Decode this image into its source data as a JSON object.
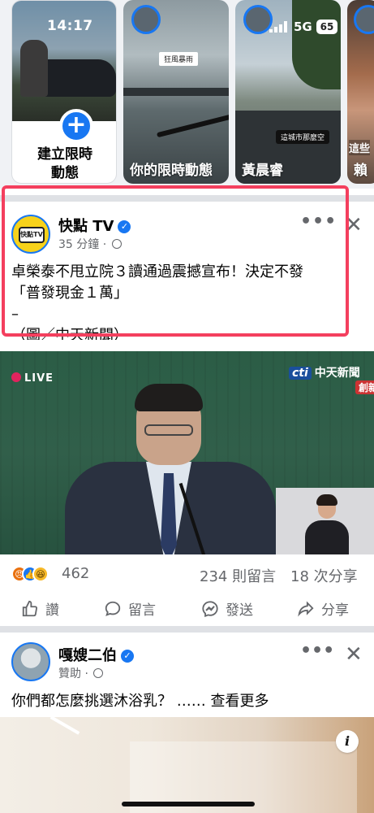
{
  "status_bar": {
    "time": "14:17",
    "network": "5G",
    "battery": "65"
  },
  "stories": {
    "create": {
      "label_line1": "建立限時",
      "label_line2": "動態"
    },
    "items": [
      {
        "name": "你的限時動態",
        "tag": "狂風暴雨"
      },
      {
        "name": "黃晨睿",
        "tag": "這城市那麼空"
      },
      {
        "name": "賴",
        "tag": "這些"
      }
    ]
  },
  "post1": {
    "page_name": "快點 TV",
    "avatar_text": "快點TV",
    "time": "35 分鐘",
    "text_line1": "卓榮泰不甩立院３讀通過震撼宣布！決定不發",
    "text_line2": "「普發現金１萬」",
    "text_line3": "–",
    "text_line4": "（圖／中天新聞）",
    "video": {
      "live_label": "LIVE",
      "channel_logo": "cti",
      "channel_name": "中天新聞",
      "channel_sub": "創新"
    },
    "reaction_count": "462",
    "comments": "234 則留言",
    "shares": "18 次分享",
    "actions": {
      "like": "讚",
      "comment": "留言",
      "send": "發送",
      "share": "分享"
    }
  },
  "post2": {
    "page_name": "嘎嫂二伯",
    "sponsored": "贊助",
    "text": "你們都怎麼挑選沐浴乳？ ……",
    "see_more": "查看更多",
    "info_icon": "i"
  },
  "colors": {
    "accent": "#1877f2",
    "highlight": "#f43f5e",
    "muted": "#65676b"
  }
}
